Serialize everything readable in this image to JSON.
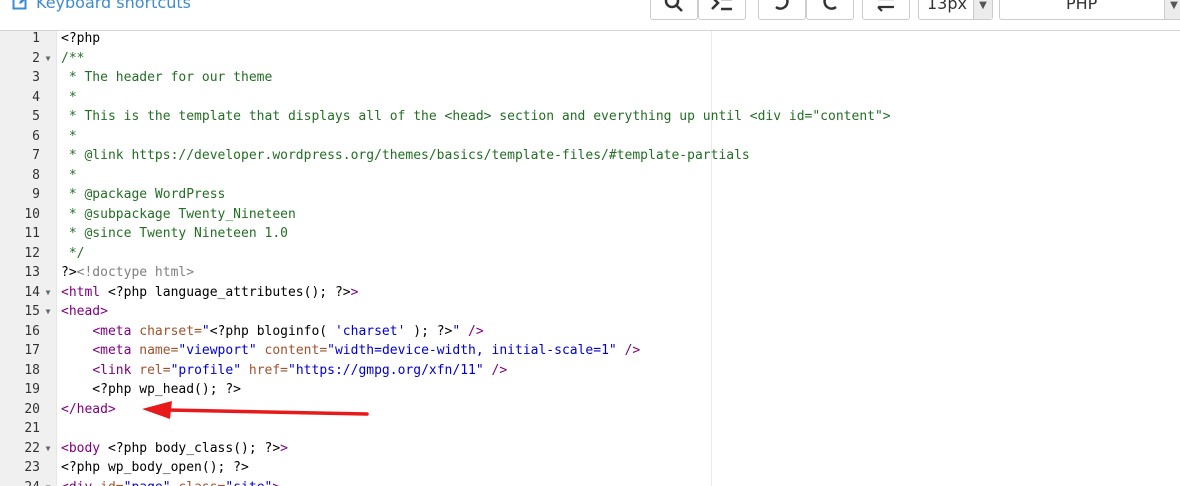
{
  "toolbar": {
    "keyboard_shortcuts": "Keyboard shortcuts",
    "font_size": "13px",
    "language": "PHP"
  },
  "colors": {
    "accent": "#3f8bcc",
    "arrow": "#e8191a",
    "comment": "#236e24",
    "tag": "#800080",
    "attribute": "#a0522d",
    "string": "#0000cd"
  },
  "editor": {
    "lines": [
      {
        "n": "1",
        "fold": "",
        "tokens": [
          {
            "t": "<?php",
            "c": "php"
          }
        ]
      },
      {
        "n": "2",
        "fold": "▼",
        "tokens": [
          {
            "t": "/**",
            "c": "comment"
          }
        ]
      },
      {
        "n": "3",
        "fold": "",
        "tokens": [
          {
            "t": " * The header for our theme",
            "c": "comment"
          }
        ]
      },
      {
        "n": "4",
        "fold": "",
        "tokens": [
          {
            "t": " *",
            "c": "comment"
          }
        ]
      },
      {
        "n": "5",
        "fold": "",
        "tokens": [
          {
            "t": " * This is the template that displays all of the <head> section and everything up until <div id=\"content\">",
            "c": "comment"
          }
        ]
      },
      {
        "n": "6",
        "fold": "",
        "tokens": [
          {
            "t": " *",
            "c": "comment"
          }
        ]
      },
      {
        "n": "7",
        "fold": "",
        "tokens": [
          {
            "t": " * @link https://developer.wordpress.org/themes/basics/template-files/#template-partials",
            "c": "comment"
          }
        ]
      },
      {
        "n": "8",
        "fold": "",
        "tokens": [
          {
            "t": " *",
            "c": "comment"
          }
        ]
      },
      {
        "n": "9",
        "fold": "",
        "tokens": [
          {
            "t": " * @package WordPress",
            "c": "comment"
          }
        ]
      },
      {
        "n": "10",
        "fold": "",
        "tokens": [
          {
            "t": " * @subpackage Twenty_Nineteen",
            "c": "comment"
          }
        ]
      },
      {
        "n": "11",
        "fold": "",
        "tokens": [
          {
            "t": " * @since Twenty Nineteen 1.0",
            "c": "comment"
          }
        ]
      },
      {
        "n": "12",
        "fold": "",
        "tokens": [
          {
            "t": " */",
            "c": "comment"
          }
        ]
      },
      {
        "n": "13",
        "fold": "",
        "tokens": [
          {
            "t": "?>",
            "c": "php"
          },
          {
            "t": "<!doctype html>",
            "c": "doctype"
          }
        ]
      },
      {
        "n": "14",
        "fold": "▼",
        "tokens": [
          {
            "t": "<html",
            "c": "tag"
          },
          {
            "t": " <?php language_attributes(); ?>",
            "c": "php"
          },
          {
            "t": ">",
            "c": "tag"
          }
        ]
      },
      {
        "n": "15",
        "fold": "▼",
        "tokens": [
          {
            "t": "<head>",
            "c": "tag"
          }
        ]
      },
      {
        "n": "16",
        "fold": "",
        "tokens": [
          {
            "t": "    ",
            "c": "text"
          },
          {
            "t": "<meta",
            "c": "tag"
          },
          {
            "t": " charset=",
            "c": "attr"
          },
          {
            "t": "\"",
            "c": "string"
          },
          {
            "t": "<?php bloginfo( ",
            "c": "php"
          },
          {
            "t": "'charset'",
            "c": "string"
          },
          {
            "t": " ); ?>",
            "c": "php"
          },
          {
            "t": "\"",
            "c": "string"
          },
          {
            "t": " />",
            "c": "tag"
          }
        ]
      },
      {
        "n": "17",
        "fold": "",
        "tokens": [
          {
            "t": "    ",
            "c": "text"
          },
          {
            "t": "<meta",
            "c": "tag"
          },
          {
            "t": " name=",
            "c": "attr"
          },
          {
            "t": "\"viewport\"",
            "c": "string"
          },
          {
            "t": " content=",
            "c": "attr"
          },
          {
            "t": "\"width=device-width, initial-scale=1\"",
            "c": "string"
          },
          {
            "t": " />",
            "c": "tag"
          }
        ]
      },
      {
        "n": "18",
        "fold": "",
        "tokens": [
          {
            "t": "    ",
            "c": "text"
          },
          {
            "t": "<link",
            "c": "tag"
          },
          {
            "t": " rel=",
            "c": "attr"
          },
          {
            "t": "\"profile\"",
            "c": "string"
          },
          {
            "t": " href=",
            "c": "attr"
          },
          {
            "t": "\"https://gmpg.org/xfn/11\"",
            "c": "string"
          },
          {
            "t": " />",
            "c": "tag"
          }
        ]
      },
      {
        "n": "19",
        "fold": "",
        "tokens": [
          {
            "t": "    <?php wp_head(); ?>",
            "c": "php"
          }
        ]
      },
      {
        "n": "20",
        "fold": "",
        "tokens": [
          {
            "t": "</head>",
            "c": "tag"
          }
        ]
      },
      {
        "n": "21",
        "fold": "",
        "tokens": [
          {
            "t": "",
            "c": "text"
          }
        ]
      },
      {
        "n": "22",
        "fold": "▼",
        "tokens": [
          {
            "t": "<body",
            "c": "tag"
          },
          {
            "t": " <?php body_class(); ?>",
            "c": "php"
          },
          {
            "t": ">",
            "c": "tag"
          }
        ]
      },
      {
        "n": "23",
        "fold": "",
        "tokens": [
          {
            "t": "<?php wp_body_open(); ?>",
            "c": "php"
          }
        ]
      },
      {
        "n": "24",
        "fold": "▼",
        "tokens": [
          {
            "t": "<div",
            "c": "tag"
          },
          {
            "t": " id=",
            "c": "attr"
          },
          {
            "t": "\"page\"",
            "c": "string"
          },
          {
            "t": " class=",
            "c": "attr"
          },
          {
            "t": "\"site\"",
            "c": "string"
          },
          {
            "t": ">",
            "c": "tag"
          }
        ]
      }
    ]
  }
}
